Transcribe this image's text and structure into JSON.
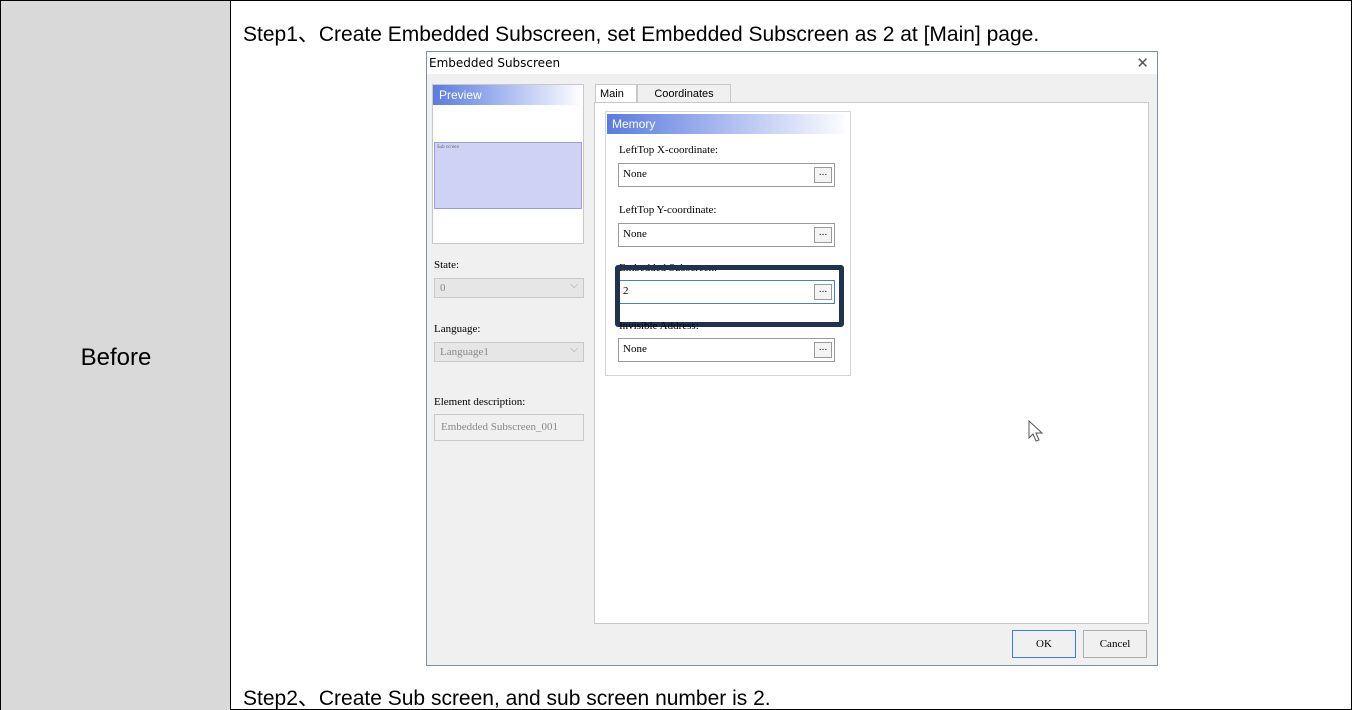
{
  "left_label": "Before",
  "step1": "Step1、Create Embedded Subscreen, set Embedded Subscreen as 2 at [Main] page.",
  "step2": "Step2、Create Sub screen, and sub screen number is 2.",
  "dialog": {
    "title": "Embedded Subscreen",
    "preview": {
      "header": "Preview",
      "thumbnail_label": "Sub screen"
    },
    "state": {
      "label": "State:",
      "value": "0"
    },
    "language": {
      "label": "Language:",
      "value": "Language1"
    },
    "element_description": {
      "label": "Element description:",
      "value": "Embedded Subscreen_001"
    },
    "tabs": [
      "Main",
      "Coordinates"
    ],
    "active_tab": "Main",
    "memory": {
      "header": "Memory",
      "fields": [
        {
          "label": "LeftTop X-coordinate:",
          "value": "None"
        },
        {
          "label": "LeftTop Y-coordinate:",
          "value": "None"
        },
        {
          "label": "Embedded Subscreen:",
          "value": "2"
        },
        {
          "label": "Invisible Address:",
          "value": "None"
        }
      ],
      "ellipsis": "..."
    },
    "buttons": {
      "ok": "OK",
      "cancel": "Cancel"
    }
  },
  "icons": {
    "close": "close-icon",
    "dropdown": "chevron-down-icon",
    "cursor": "mouse-pointer-icon"
  },
  "colors": {
    "left_cell_bg": "#d9d9d9",
    "header_gradient": "#5a7be0",
    "preview_fill": "#d0d2f5",
    "highlight_border": "#1f3350"
  }
}
